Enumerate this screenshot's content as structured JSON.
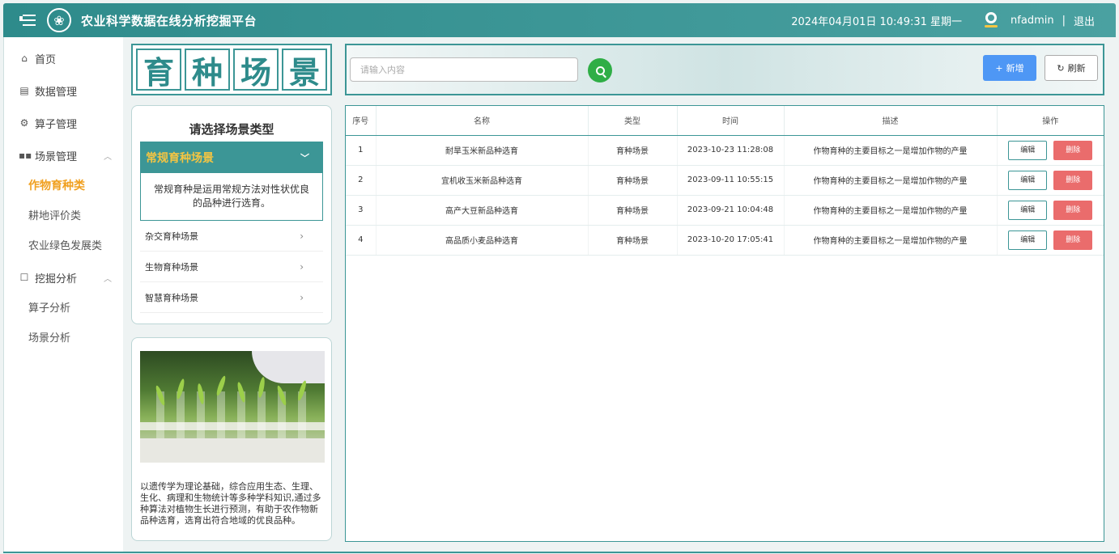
{
  "header": {
    "title": "农业科学数据在线分析挖掘平台",
    "datetime": "2024年04月01日 10:49:31 星期一",
    "username": "nfadmin",
    "separator": "|",
    "logout_label": "退出"
  },
  "sidebar": {
    "home": "首页",
    "data_mgmt": "数据管理",
    "operator_mgmt": "算子管理",
    "scene_mgmt": "场景管理",
    "scene_sub": [
      "作物育种类",
      "耕地评价类",
      "农业绿色发展类"
    ],
    "mining": "挖掘分析",
    "mining_sub": [
      "算子分析",
      "场景分析"
    ]
  },
  "scene_title_chars": [
    "育",
    "种",
    "场",
    "景"
  ],
  "type_panel": {
    "title": "请选择场景类型",
    "active": {
      "label": "常规育种场景",
      "description": "常规育种是运用常规方法对性状优良的品种进行选育。"
    },
    "items": [
      "杂交育种场景",
      "生物育种场景",
      "智慧育种场景"
    ]
  },
  "info_panel": {
    "text": "以遗传学为理论基础，综合应用生态、生理、生化、病理和生物统计等多种学科知识,通过多种算法对植物生长进行预测，有助于农作物新品种选育，选育出符合地域的优良品种。"
  },
  "toolbar": {
    "search_placeholder": "请输入内容",
    "add_label": "新增",
    "refresh_label": "刷新"
  },
  "table": {
    "columns": [
      "序号",
      "名称",
      "类型",
      "时间",
      "描述",
      "操作"
    ],
    "edit_label": "编辑",
    "delete_label": "删除",
    "rows": [
      {
        "no": "1",
        "name": "耐旱玉米新品种选育",
        "type": "育种场景",
        "time": "2023-10-23 11:28:08",
        "desc": "作物育种的主要目标之一是增加作物的产量"
      },
      {
        "no": "2",
        "name": "宜机收玉米新品种选育",
        "type": "育种场景",
        "time": "2023-09-11 10:55:15",
        "desc": "作物育种的主要目标之一是增加作物的产量"
      },
      {
        "no": "3",
        "name": "高产大豆新品种选育",
        "type": "育种场景",
        "time": "2023-09-21 10:04:48",
        "desc": "作物育种的主要目标之一是增加作物的产量"
      },
      {
        "no": "4",
        "name": "高品质小麦品种选育",
        "type": "育种场景",
        "time": "2023-10-20 17:05:41",
        "desc": "作物育种的主要目标之一是增加作物的产量"
      }
    ]
  },
  "colors": {
    "primary": "#3c9696",
    "accent": "#f0a020",
    "add_button": "#4e97f5",
    "delete_button": "#ea6c6c",
    "search_button": "#2fae46"
  },
  "icons": {
    "menu": "menu-collapse-icon",
    "logo": "emblem-icon",
    "user": "user-icon",
    "home": "home-icon",
    "data": "document-icon",
    "operator": "gear-icon",
    "scene": "grid-icon",
    "mining": "chart-icon",
    "search": "search-icon",
    "add": "plus-icon",
    "refresh": "refresh-icon"
  }
}
